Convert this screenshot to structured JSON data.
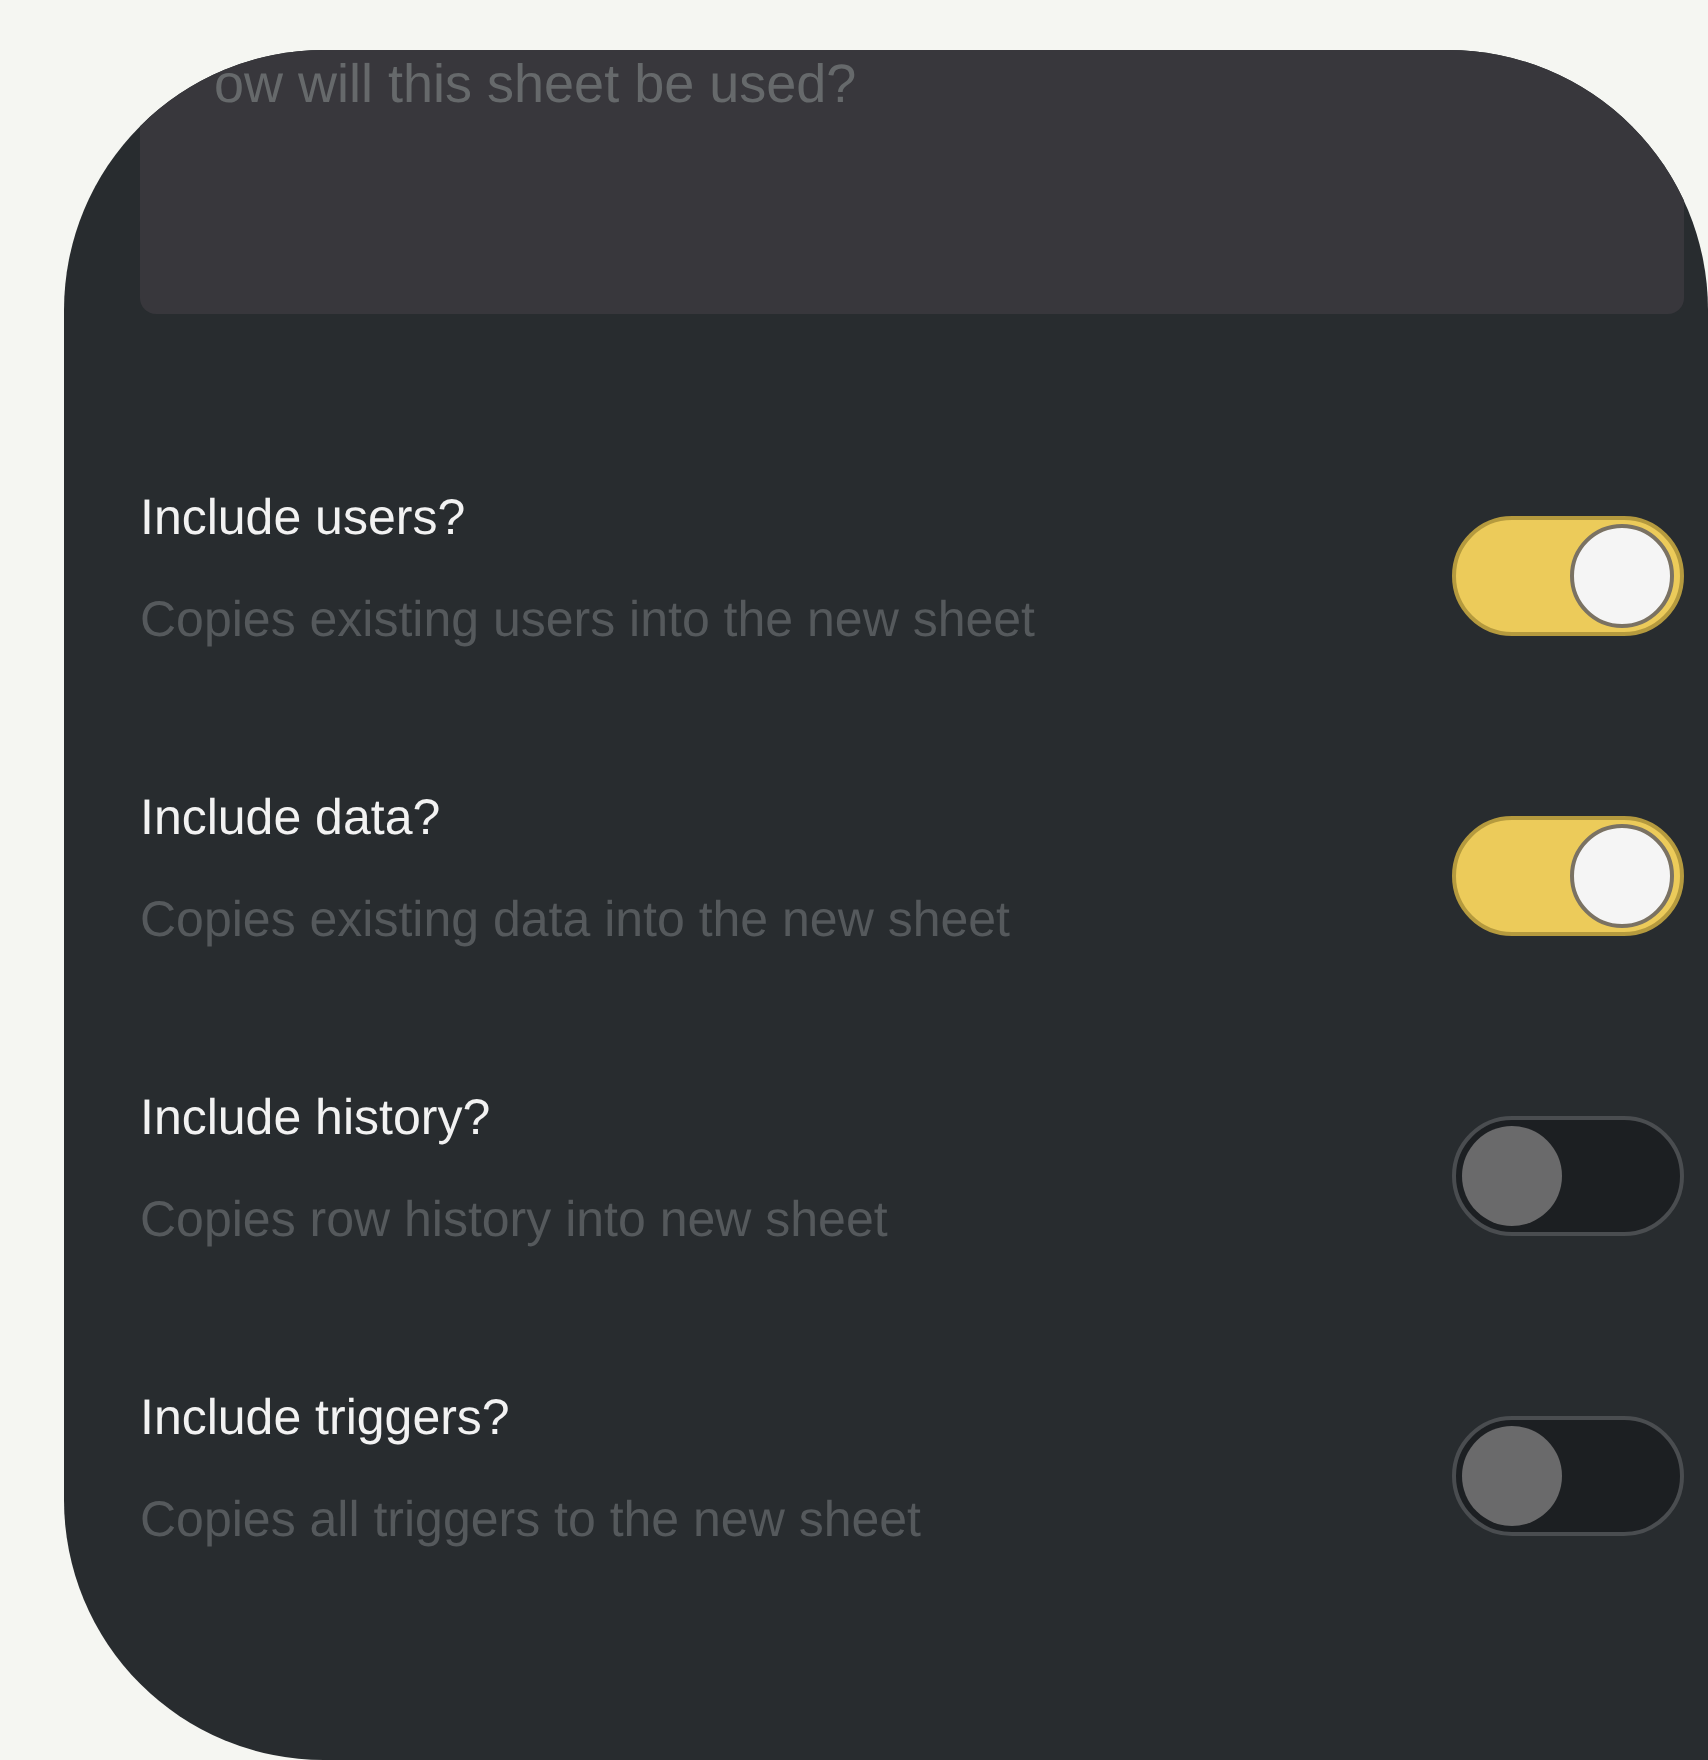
{
  "description_field": {
    "placeholder": "ow will this sheet be used?"
  },
  "options": [
    {
      "label": "Include users?",
      "hint": "Copies existing users into the new sheet",
      "on": true
    },
    {
      "label": "Include data?",
      "hint": "Copies existing data into the new sheet",
      "on": true
    },
    {
      "label": "Include history?",
      "hint": "Copies row history into new sheet",
      "on": false
    },
    {
      "label": "Include triggers?",
      "hint": "Copies all triggers to the new sheet",
      "on": false
    }
  ]
}
